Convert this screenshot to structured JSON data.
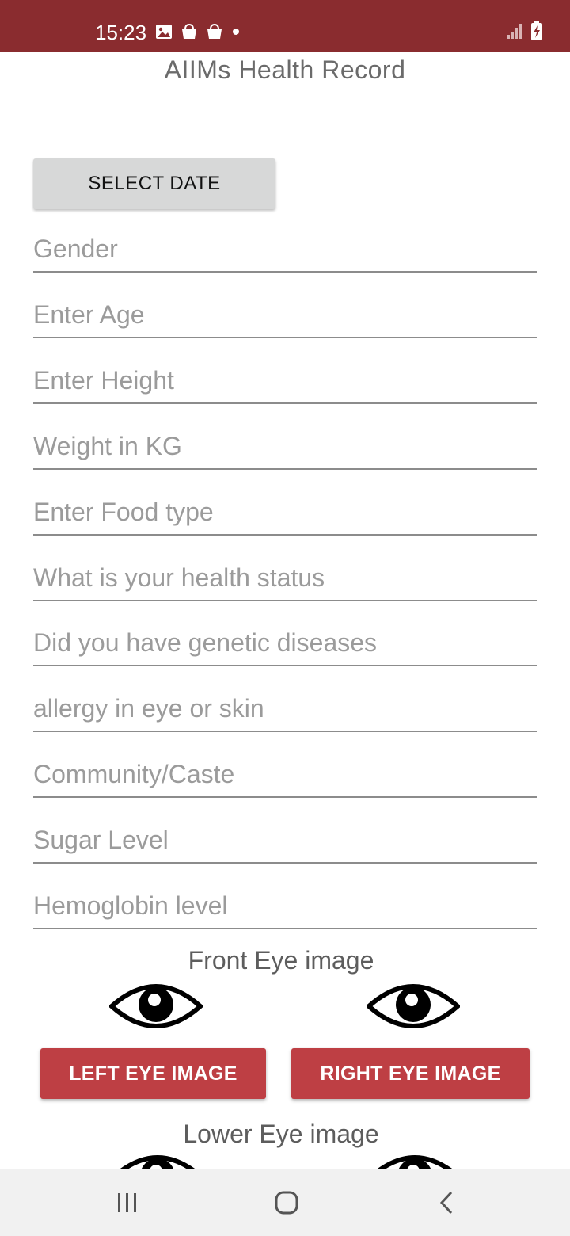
{
  "status_bar": {
    "time": "15:23",
    "left_icons": [
      "gallery-icon",
      "shopping-bag-icon",
      "shopping-bag-icon",
      "notification-dot-icon"
    ],
    "right_icons": [
      "signal-icon",
      "battery-charging-icon"
    ],
    "background": "#8a2c2f"
  },
  "app": {
    "title": "AIIMs Health Record"
  },
  "date_button": {
    "label": "SELECT DATE"
  },
  "form": {
    "fields": [
      {
        "placeholder": "Gender",
        "value": ""
      },
      {
        "placeholder": "Enter Age",
        "value": ""
      },
      {
        "placeholder": "Enter Height",
        "value": ""
      },
      {
        "placeholder": "Weight in KG",
        "value": ""
      },
      {
        "placeholder": "Enter Food type",
        "value": ""
      },
      {
        "placeholder": "What is your health status",
        "value": ""
      },
      {
        "placeholder": "Did you have genetic diseases",
        "value": ""
      },
      {
        "placeholder": "allergy in eye or skin",
        "value": ""
      },
      {
        "placeholder": "Community/Caste",
        "value": ""
      },
      {
        "placeholder": "Sugar Level",
        "value": ""
      },
      {
        "placeholder": "Hemoglobin level",
        "value": ""
      }
    ]
  },
  "front_eye": {
    "title": "Front Eye image",
    "left_button": "LEFT EYE IMAGE",
    "right_button": "RIGHT EYE IMAGE"
  },
  "lower_eye": {
    "title": "Lower Eye image"
  },
  "nav_bar": {
    "items": [
      "recent-apps-icon",
      "home-icon",
      "back-icon"
    ]
  },
  "colors": {
    "accent_button": "#be3f44",
    "status_bar": "#8a2c2f",
    "date_button": "#d7d8d8"
  }
}
